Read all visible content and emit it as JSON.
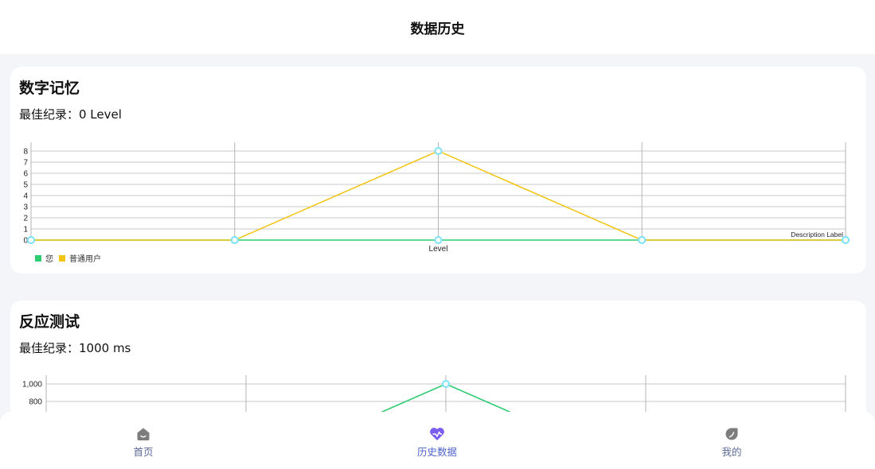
{
  "header": {
    "title": "数据历史"
  },
  "cards": [
    {
      "title": "数字记忆",
      "best": "最佳纪录：0 Level"
    },
    {
      "title": "反应测试",
      "best": "最佳纪录：1000 ms"
    }
  ],
  "chart_data": [
    {
      "type": "line",
      "x": [
        0,
        1,
        2,
        3,
        4
      ],
      "xlabel": "Level",
      "description": "Description Label",
      "ylim": [
        0,
        8
      ],
      "yticks": [
        "0",
        "1",
        "2",
        "3",
        "4",
        "5",
        "6",
        "7",
        "8"
      ],
      "series": [
        {
          "name": "您",
          "color": "#2ecc71",
          "values": [
            0,
            0,
            0,
            0,
            0
          ]
        },
        {
          "name": "普通用户",
          "color": "#f1c40f",
          "values": [
            0,
            0,
            8,
            0,
            0
          ]
        }
      ],
      "grid": true,
      "legend": "bottom-left"
    },
    {
      "type": "line",
      "x": [
        0,
        1,
        2,
        3,
        4
      ],
      "yticks": [
        "1,000",
        "800"
      ],
      "series": [
        {
          "name": "您",
          "color": "#2ecc71",
          "values": [
            0,
            0,
            1000,
            0,
            0
          ]
        }
      ],
      "grid": true
    }
  ],
  "tabs": [
    {
      "label": "首页",
      "icon": "home-icon",
      "active": false,
      "color": "#5b6a96"
    },
    {
      "label": "历史数据",
      "icon": "heart-chart-icon",
      "active": true,
      "color": "#4e63c8"
    },
    {
      "label": "我的",
      "icon": "leaf-profile-icon",
      "active": false,
      "color": "#5b6a96"
    }
  ],
  "colors": {
    "accent": "#7b5cf0",
    "point": "#7ee3f5",
    "grid": "#c8c8c8"
  }
}
